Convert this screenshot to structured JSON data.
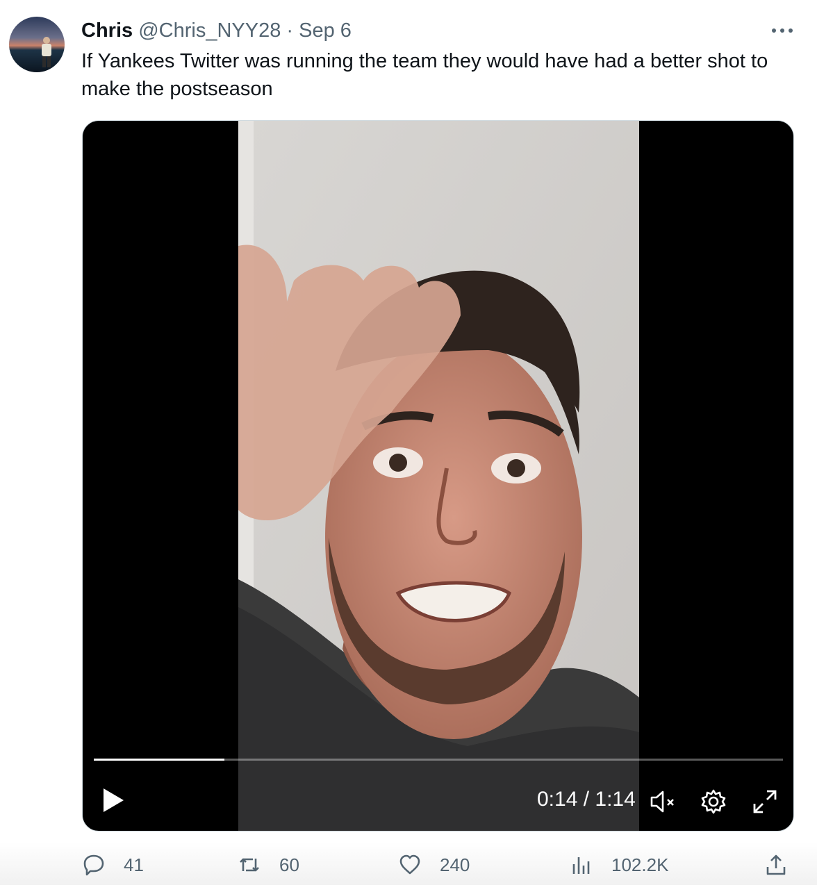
{
  "tweet": {
    "display_name": "Chris",
    "handle": "@Chris_NYY28",
    "separator": "·",
    "date": "Sep 6",
    "text": "If Yankees Twitter was running the team they would have had a better shot to make the postseason"
  },
  "video": {
    "current_time": "0:14",
    "duration": "1:14",
    "time_display": "0:14 / 1:14",
    "progress_fraction": 0.19,
    "muted": true
  },
  "actions": {
    "replies": "41",
    "reposts": "60",
    "likes": "240",
    "views": "102.2K"
  },
  "icons": [
    "more-icon",
    "play-icon",
    "mute-icon",
    "settings-icon",
    "fullscreen-icon",
    "reply-icon",
    "repost-icon",
    "like-icon",
    "views-icon",
    "share-icon"
  ]
}
